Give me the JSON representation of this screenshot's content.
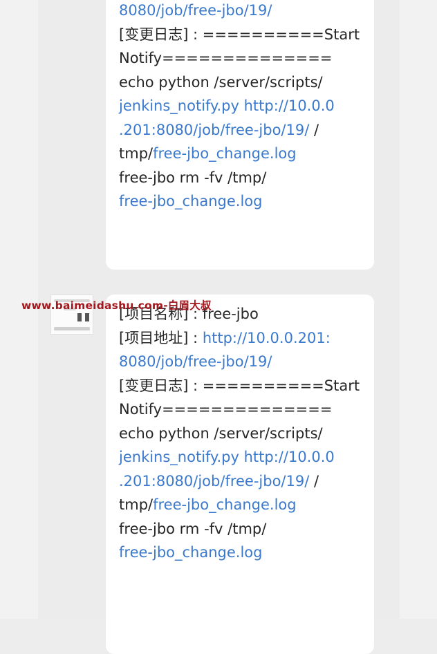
{
  "watermark": "www.baimeidashu.com-白眉大叔",
  "messages": [
    {
      "lines": [
        [
          {
            "t": "8080/job/free-jbo/19/",
            "link": true
          }
        ],
        [
          {
            "t": "[变更日志] : ==========Start",
            "link": false
          }
        ],
        [
          {
            "t": "Notify==============",
            "link": false
          }
        ],
        [
          {
            "t": "echo python /server/scripts/",
            "link": false
          }
        ],
        [
          {
            "t": "jenkins_notify.py",
            "link": true
          },
          {
            "t": " ",
            "link": false
          },
          {
            "t": "http://10.0.0",
            "link": true
          }
        ],
        [
          {
            "t": ".201:8080/job/free-jbo/19/",
            "link": true
          },
          {
            "t": " /",
            "link": false
          }
        ],
        [
          {
            "t": "tmp/",
            "link": false
          },
          {
            "t": "free-jbo_change.log",
            "link": true
          }
        ],
        [
          {
            "t": "free-jbo rm -fv /tmp/",
            "link": false
          }
        ],
        [
          {
            "t": "free-jbo_change.log",
            "link": true
          }
        ]
      ]
    },
    {
      "lines": [
        [
          {
            "t": "[项目名称] : free-jbo",
            "link": false
          }
        ],
        [
          {
            "t": "[项目地址] : ",
            "link": false
          },
          {
            "t": "http://10.0.0.201:",
            "link": true
          }
        ],
        [
          {
            "t": "8080/job/free-jbo/19/",
            "link": true
          }
        ],
        [
          {
            "t": "[变更日志] : ==========Start",
            "link": false
          }
        ],
        [
          {
            "t": "Notify==============",
            "link": false
          }
        ],
        [
          {
            "t": "echo python /server/scripts/",
            "link": false
          }
        ],
        [
          {
            "t": "jenkins_notify.py",
            "link": true
          },
          {
            "t": " ",
            "link": false
          },
          {
            "t": "http://10.0.0",
            "link": true
          }
        ],
        [
          {
            "t": ".201:8080/job/free-jbo/19/",
            "link": true
          },
          {
            "t": " /",
            "link": false
          }
        ],
        [
          {
            "t": "tmp/",
            "link": false
          },
          {
            "t": "free-jbo_change.log",
            "link": true
          }
        ],
        [
          {
            "t": "free-jbo rm -fv /tmp/",
            "link": false
          }
        ],
        [
          {
            "t": "free-jbo_change.log",
            "link": true
          }
        ]
      ]
    }
  ]
}
